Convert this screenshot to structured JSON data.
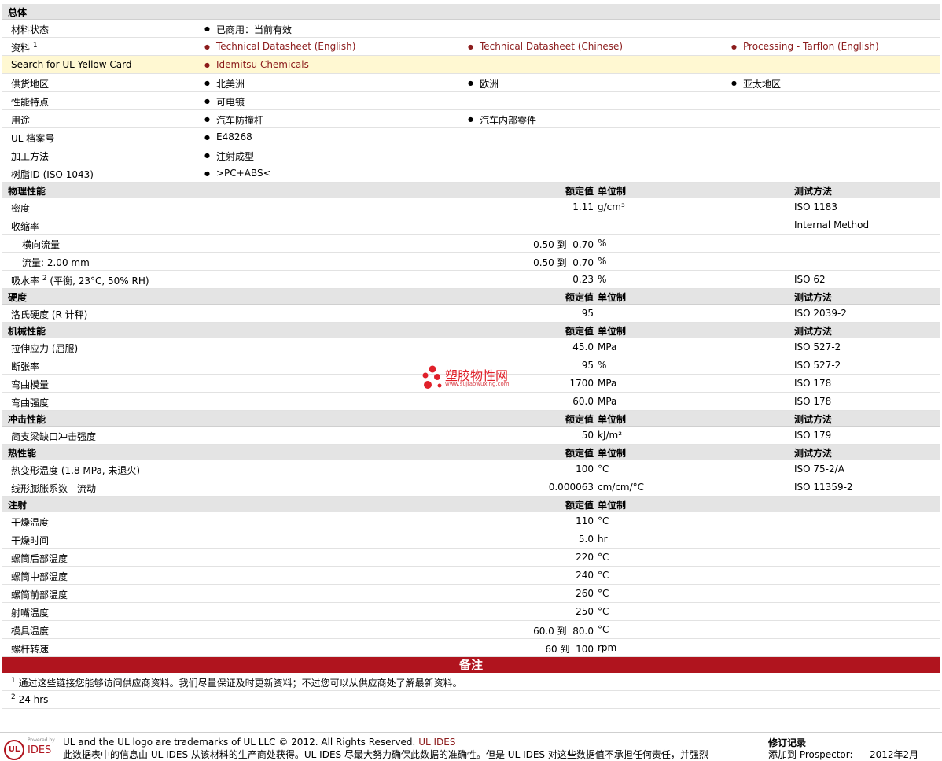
{
  "general": {
    "title": "总体",
    "material_status": {
      "label": "材料状态",
      "value": "已商用：当前有效"
    },
    "docs": {
      "label": "资料",
      "note": "1",
      "links": [
        "Technical Datasheet (English)",
        "Technical Datasheet (Chinese)",
        "Processing - Tarflon (English)"
      ]
    },
    "yellow": {
      "label": "Search for UL Yellow Card",
      "value": "Idemitsu Chemicals"
    },
    "region": {
      "label": "供货地区",
      "values": [
        "北美洲",
        "欧洲",
        "亚太地区"
      ]
    },
    "features": {
      "label": "性能特点",
      "value": "可电镀"
    },
    "uses": {
      "label": "用途",
      "values": [
        "汽车防撞杆",
        "汽车内部零件"
      ]
    },
    "ul_file": {
      "label": "UL 档案号",
      "value": "E48268"
    },
    "processing": {
      "label": "加工方法",
      "value": "注射成型"
    },
    "resin": {
      "label": "树脂ID (ISO 1043)",
      "value": ">PC+ABS<"
    }
  },
  "headers": {
    "nominal": "额定值",
    "unit": "单位制",
    "method": "测试方法"
  },
  "physical": {
    "title": "物理性能",
    "density": {
      "label": "密度",
      "value": "1.11",
      "unit": "g/cm³",
      "method": "ISO 1183"
    },
    "shrink": {
      "label": "收缩率",
      "method": "Internal Method"
    },
    "shrink_td": {
      "label": "横向流量",
      "from": "0.50",
      "to": "到",
      "value": "0.70",
      "unit": "%"
    },
    "shrink_flow": {
      "label": "流量: 2.00 mm",
      "from": "0.50",
      "to": "到",
      "value": "0.70",
      "unit": "%"
    },
    "water": {
      "label": "吸水率",
      "note": "2",
      "label2": "(平衡, 23°C, 50% RH)",
      "value": "0.23",
      "unit": "%",
      "method": "ISO 62"
    }
  },
  "hardness": {
    "title": "硬度",
    "rockwell": {
      "label": "洛氏硬度 (R 计秤)",
      "value": "95",
      "method": "ISO 2039-2"
    }
  },
  "mechanical": {
    "title": "机械性能",
    "tensile": {
      "label": "拉伸应力 (屈服)",
      "value": "45.0",
      "unit": "MPa",
      "method": "ISO 527-2"
    },
    "elong": {
      "label": "断张率",
      "value": "95",
      "unit": "%",
      "method": "ISO 527-2"
    },
    "flex_mod": {
      "label": "弯曲模量",
      "value": "1700",
      "unit": "MPa",
      "method": "ISO 178"
    },
    "flex_str": {
      "label": "弯曲强度",
      "value": "60.0",
      "unit": "MPa",
      "method": "ISO 178"
    }
  },
  "impact": {
    "title": "冲击性能",
    "charpy": {
      "label": "简支梁缺口冲击强度",
      "value": "50",
      "unit": "kJ/m²",
      "method": "ISO 179"
    }
  },
  "thermal": {
    "title": "热性能",
    "hdt": {
      "label": "热变形温度 (1.8 MPa, 未退火)",
      "value": "100",
      "unit": "°C",
      "method": "ISO 75-2/A"
    },
    "clte": {
      "label": "线形膨胀系数 - 流动",
      "value": "0.000063",
      "unit": "cm/cm/°C",
      "method": "ISO 11359-2"
    }
  },
  "injection": {
    "title": "注射",
    "rows": [
      {
        "label": "干燥温度",
        "value": "110",
        "unit": "°C"
      },
      {
        "label": "干燥时间",
        "value": "5.0",
        "unit": "hr"
      },
      {
        "label": "螺筒后部温度",
        "value": "220",
        "unit": "°C"
      },
      {
        "label": "螺筒中部温度",
        "value": "240",
        "unit": "°C"
      },
      {
        "label": "螺筒前部温度",
        "value": "260",
        "unit": "°C"
      },
      {
        "label": "射嘴温度",
        "value": "250",
        "unit": "°C"
      },
      {
        "label": "模具温度",
        "from": "60.0",
        "to": "到",
        "value": "80.0",
        "unit": "°C"
      },
      {
        "label": "螺杆转速",
        "from": "60",
        "to": "到",
        "value": "100",
        "unit": "rpm"
      }
    ]
  },
  "notes": {
    "title": "备注",
    "n1": {
      "num": "1",
      "text": "通过这些链接您能够访问供应商资料。我们尽量保证及时更新资料；不过您可以从供应商处了解最新资料。"
    },
    "n2": {
      "num": "2",
      "text": "24 hrs"
    }
  },
  "watermark": {
    "name": "塑胶物性网",
    "url": "www.sujiaowuxing.com"
  },
  "footer": {
    "logo_powered": "Powered by",
    "logo_ul": "UL",
    "logo_ides": "IDES",
    "trademark": "UL and the UL logo are trademarks of UL LLC © 2012. All Rights Reserved.",
    "ul_ides_link": "UL IDES",
    "disclaimer": "此数据表中的信息由 UL IDES 从该材料的生产商处获得。UL IDES 尽最大努力确保此数据的准确性。但是 UL IDES 对这些数据值不承担任何责任，并强烈",
    "revision_title": "修订记录",
    "revision_added": "添加到 Prospector:",
    "revision_date": "2012年2月"
  }
}
